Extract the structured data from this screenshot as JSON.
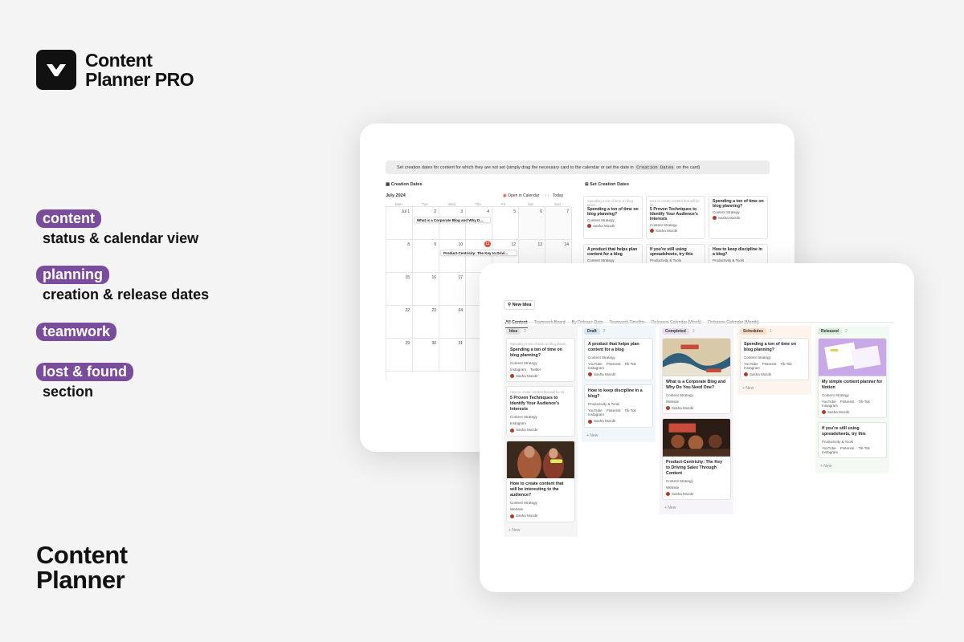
{
  "brand": {
    "line1": "Content",
    "line2": "Planner PRO"
  },
  "features": [
    {
      "pill": "content",
      "text": "status & calendar view"
    },
    {
      "pill": "planning",
      "text": "creation & release dates"
    },
    {
      "pill": "teamwork",
      "text": ""
    },
    {
      "pill": "lost & found",
      "text": "section"
    }
  ],
  "footer_title": {
    "line1": "Content",
    "line2": "Planner"
  },
  "colors": {
    "accent": "#7a4d9c",
    "today": "#e04b3d"
  },
  "calendar_view": {
    "notice_pre": "Set creation dates for content for which they are not set (simply drag the necessary card to the calendar or set the date in",
    "notice_code": "Creation Dates",
    "notice_post": "on the card)",
    "creation_dates_label": "Creation Dates",
    "set_creation_dates_label": "Set Creation Dates",
    "month": "July 2024",
    "open_in_calendar": "Open in Calendar",
    "today": "Today",
    "weekdays": [
      "Mon",
      "Tue",
      "Wed",
      "Thu",
      "Fri",
      "Sat",
      "Sun"
    ],
    "weeks": [
      [
        "Jul 1",
        "2",
        "3",
        "4",
        "5",
        "6",
        "7"
      ],
      [
        "8",
        "9",
        "10",
        "11",
        "12",
        "13",
        "14"
      ],
      [
        "15",
        "16",
        "17",
        "",
        "",
        "",
        ""
      ],
      [
        "22",
        "23",
        "24",
        "",
        "",
        "",
        ""
      ],
      [
        "29",
        "30",
        "31",
        "",
        "",
        "",
        ""
      ]
    ],
    "events": [
      "What is a Corporate Blog and Why D...",
      "Product-Centricity: The Key to Drivi..."
    ],
    "unset_cards": [
      {
        "hint": "Spending a ton of time on blog plann...",
        "title": "Spending a ton of time on blog planning?",
        "tag": "Content Strategy",
        "author": "Sasha Mozdir"
      },
      {
        "hint": "How to create content that will be int...",
        "title": "5 Proven Techniques to Identify Your Audience's Interests",
        "tag": "Content Strategy",
        "author": "Sasha Mozdir"
      },
      {
        "hint": "",
        "title": "Spending a ton of time on blog planning?",
        "tag": "Content Strategy",
        "author": "Sasha Mozdir"
      },
      {
        "hint": "",
        "title": "A product that helps plan content for a blog",
        "tag": "Content Strategy",
        "author": ""
      },
      {
        "hint": "",
        "title": "If you're still using spreadsheets, try this",
        "tag": "Productivity & Tools",
        "author": ""
      },
      {
        "hint": "",
        "title": "How to keep discipline in a blog?",
        "tag": "Productivity & Tools",
        "author": ""
      }
    ]
  },
  "board_view": {
    "new_idea": "New Idea",
    "tabs": [
      "All Content",
      "Teamwork Board",
      "By Release Date",
      "Teamwork Timeline",
      "Releases Calendar (Week)",
      "Releases Calendar (Month)"
    ],
    "new_label": "+ New",
    "columns": [
      {
        "name": "Idea",
        "count": "3",
        "color": "#e3e2e0",
        "cards": [
          {
            "hint": "Spending a ton of time on blog planni...",
            "title": "Spending a ton of time on blog planning?",
            "tag": "Content Strategy",
            "channels": [
              "Instagram",
              "Twitter"
            ],
            "author": "Sasha Mozdir",
            "cover": ""
          },
          {
            "hint": "How to create content that will be int...",
            "title": "5 Proven Techniques to Identify Your Audience's Interests",
            "tag": "Content Strategy",
            "channels": [
              "Instagram"
            ],
            "author": "Sasha Mozdir",
            "cover": ""
          },
          {
            "hint": "",
            "title": "How to create content that will be interesting to the audience?",
            "tag": "Content Strategy",
            "channels": [
              "Website"
            ],
            "author": "Sasha Mozdir",
            "cover": "painting-two-figures"
          }
        ]
      },
      {
        "name": "Draft",
        "count": "2",
        "color": "#d3e5ef",
        "cards": [
          {
            "hint": "",
            "title": "A product that helps plan content for a blog",
            "tag": "Content Strategy",
            "channels": [
              "YouTube",
              "Pinterest",
              "Tik-Tok",
              "Instagram"
            ],
            "author": "Sasha Mozdir",
            "cover": ""
          },
          {
            "hint": "",
            "title": "How to keep discipline in a blog?",
            "tag": "Productivity & Tools",
            "channels": [
              "YouTube",
              "Pinterest",
              "Tik-Tok",
              "Instagram"
            ],
            "author": "Sasha Mozdir",
            "cover": ""
          }
        ]
      },
      {
        "name": "Completed",
        "count": "2",
        "color": "#e8deee",
        "cards": [
          {
            "hint": "",
            "title": "What is a Corporate Blog and Why Do You Need One?",
            "tag": "Content Strategy",
            "channels": [
              "Website"
            ],
            "author": "Sasha Mozdir",
            "cover": "painting-wave"
          },
          {
            "hint": "",
            "title": "Product-Centricity: The Key to Driving Sales Through Content",
            "tag": "Content Strategy",
            "channels": [
              "Website"
            ],
            "author": "Sasha Mozdir",
            "cover": "painting-supper"
          }
        ]
      },
      {
        "name": "Schedules",
        "count": "1",
        "color": "#fadec9",
        "cards": [
          {
            "hint": "",
            "title": "Spending a ton of time on blog planning?",
            "tag": "Content Strategy",
            "channels": [
              "YouTube",
              "Pinterest",
              "Tik-Tok",
              "Instagram"
            ],
            "author": "Sasha Mozdir",
            "cover": ""
          }
        ]
      },
      {
        "name": "Released",
        "count": "2",
        "color": "#dbeddb",
        "cards": [
          {
            "hint": "",
            "title": "My simple content planner for Notion",
            "tag": "Content Strategy",
            "channels": [
              "YouTube",
              "Pinterest",
              "Tik-Tok",
              "Instagram"
            ],
            "author": "Sasha Mozdir",
            "cover": "planner-preview"
          },
          {
            "hint": "",
            "title": "If you're still using spreadsheets, try this",
            "tag": "Productivity & Tools",
            "channels": [
              "YouTube",
              "Pinterest",
              "Tik-Tok",
              "Instagram"
            ],
            "author": "",
            "cover": ""
          }
        ]
      }
    ]
  }
}
